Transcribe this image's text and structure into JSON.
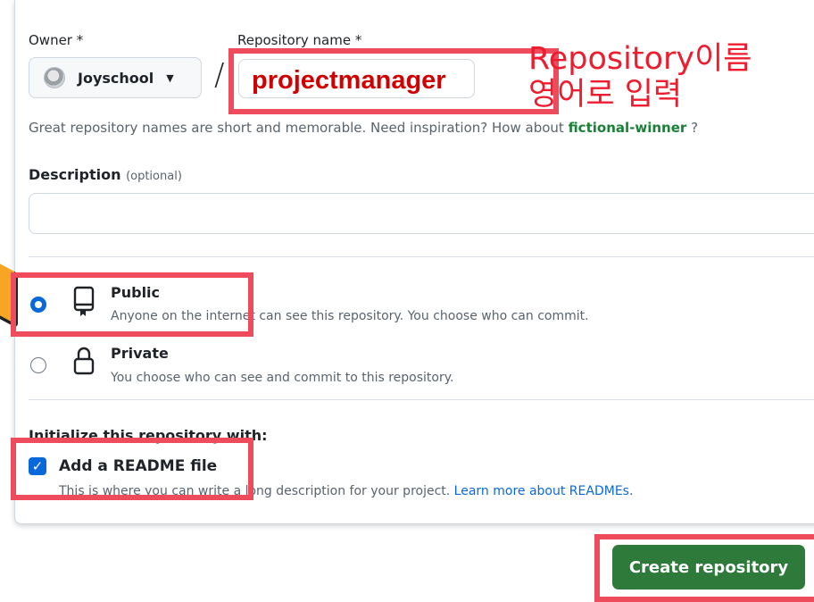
{
  "owner": {
    "label": "Owner *",
    "value": "Joyschool"
  },
  "repository": {
    "label": "Repository name *",
    "value": "projectmanager",
    "separator": "/"
  },
  "annotation": {
    "line1": "Repository이름",
    "line2": "영어로 입력",
    "color": "#ee1c2e"
  },
  "hint": {
    "text": "Great repository names are short and memorable. Need inspiration? How about ",
    "suggestion": "fictional-winner",
    "suffix": " ?"
  },
  "description": {
    "label": "Description",
    "optional": "(optional)",
    "value": ""
  },
  "visibility": {
    "public": {
      "title": "Public",
      "subtitle": "Anyone on the internet can see this repository. You choose who can commit.",
      "selected": true
    },
    "private": {
      "title": "Private",
      "subtitle": "You choose who can see and commit to this repository.",
      "selected": false
    }
  },
  "initialize": {
    "heading": "Initialize this repository with:",
    "readme_label": "Add a README file",
    "readme_checked": true,
    "readme_desc": "This is where you can write a long description for your project. ",
    "readme_link": "Learn more about READMEs."
  },
  "create_button": "Create repository",
  "colors": {
    "highlight": "#ee4c5c",
    "primary_button": "#2d7a3a",
    "accent": "#0969da",
    "suggestion": "#1a7f37"
  }
}
